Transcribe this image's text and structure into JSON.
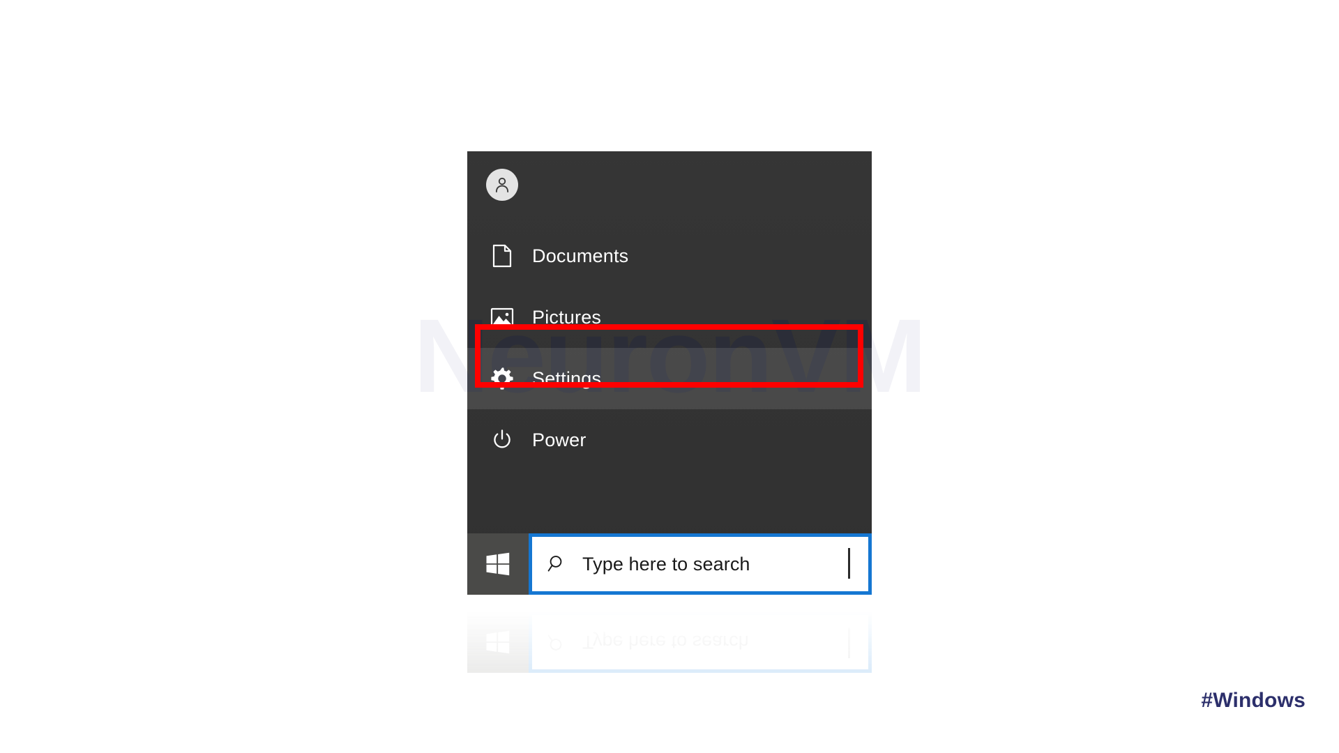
{
  "page": {
    "background_color": "#ffffff",
    "watermark_text": "NeuronVM",
    "watermark_color": "#f2f2f7",
    "hashtag": "#Windows",
    "hashtag_color": "#2c2f6b"
  },
  "start_menu": {
    "panel_color": "#333333",
    "account": {
      "icon": "user-avatar-icon",
      "label": ""
    },
    "items": [
      {
        "id": "documents",
        "icon": "document-icon",
        "label": "Documents",
        "highlighted": false
      },
      {
        "id": "pictures",
        "icon": "picture-icon",
        "label": "Pictures",
        "highlighted": false
      },
      {
        "id": "settings",
        "icon": "gear-icon",
        "label": "Settings",
        "highlighted": true
      },
      {
        "id": "power",
        "icon": "power-icon",
        "label": "Power",
        "highlighted": false
      }
    ]
  },
  "annotation": {
    "target_item": "Settings",
    "box_color": "#ff0000",
    "border_width_px": 8
  },
  "taskbar": {
    "background_color": "#4a4a48",
    "start_button": {
      "icon": "windows-logo-icon",
      "label": "Start"
    },
    "search": {
      "icon": "search-icon",
      "placeholder": "Type here to search",
      "value": "",
      "border_color": "#1577d2",
      "caret_visible": true
    }
  },
  "reflection": {
    "visible": true,
    "mirrored_text": "Type here to search"
  }
}
